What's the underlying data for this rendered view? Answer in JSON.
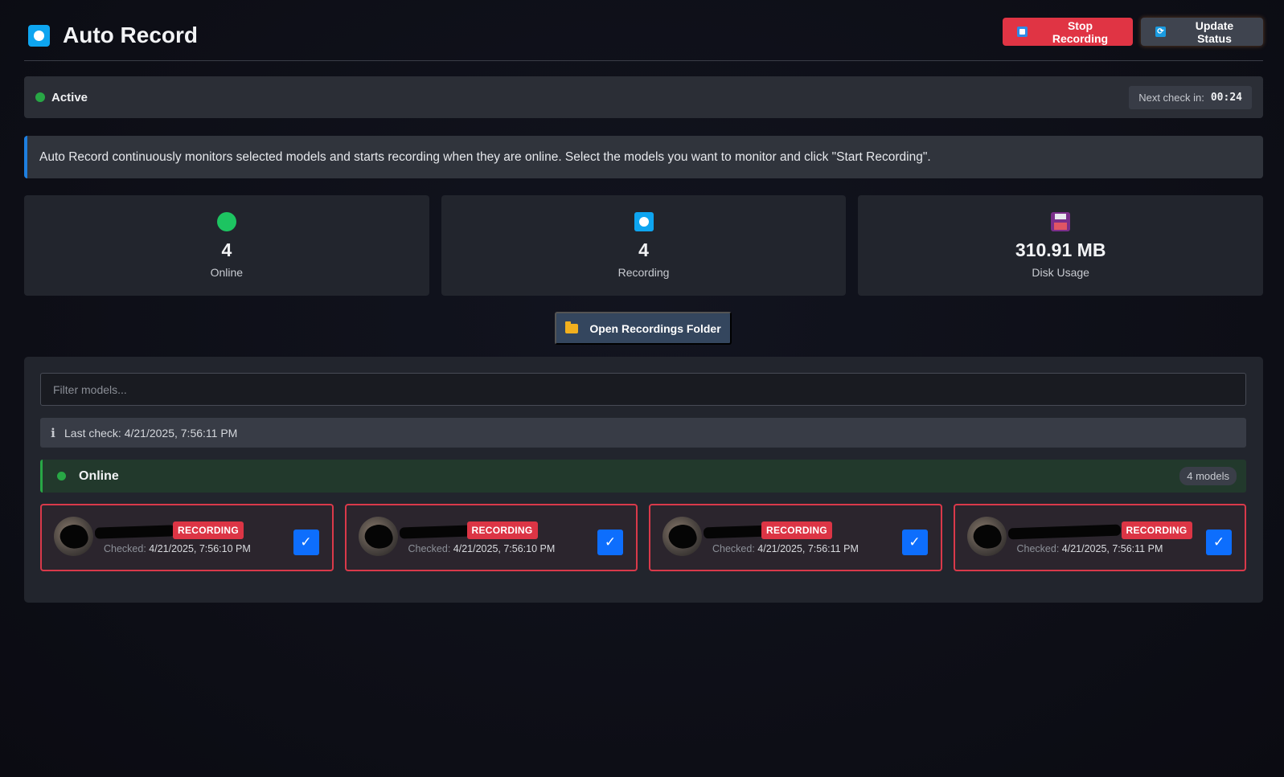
{
  "header": {
    "title": "Auto Record",
    "stop_button": "Stop Recording",
    "update_button": "Update Status"
  },
  "status": {
    "state": "Active",
    "next_check_label": "Next check in:",
    "countdown": "00:24"
  },
  "info": {
    "text": "Auto Record continuously monitors selected models and starts recording when they are online. Select the models you want to monitor and click \"Start Recording\"."
  },
  "stats": [
    {
      "icon": "green-circle-icon",
      "value": "4",
      "label": "Online"
    },
    {
      "icon": "record-icon",
      "value": "4",
      "label": "Recording"
    },
    {
      "icon": "floppy-disk-icon",
      "value": "310.91 MB",
      "label": "Disk Usage"
    }
  ],
  "open_folder": "Open Recordings Folder",
  "filter": {
    "placeholder": "Filter models..."
  },
  "last_check": "Last check: 4/21/2025, 7:56:11 PM",
  "online_section": {
    "title": "Online",
    "count": "4 models"
  },
  "models": [
    {
      "badge": "RECORDING",
      "checked_label": "Checked:",
      "checked_time": "4/21/2025, 7:56:10 PM",
      "selected": true
    },
    {
      "badge": "RECORDING",
      "checked_label": "Checked:",
      "checked_time": "4/21/2025, 7:56:10 PM",
      "selected": true
    },
    {
      "badge": "RECORDING",
      "checked_label": "Checked:",
      "checked_time": "4/21/2025, 7:56:11 PM",
      "selected": true
    },
    {
      "badge": "RECORDING",
      "checked_label": "Checked:",
      "checked_time": "4/21/2025, 7:56:11 PM",
      "selected": true
    }
  ],
  "colors": {
    "accent_blue": "#0d6efd",
    "stop_red": "#e03444",
    "online_green": "#28a745",
    "record_cyan": "#0ea5f0"
  }
}
